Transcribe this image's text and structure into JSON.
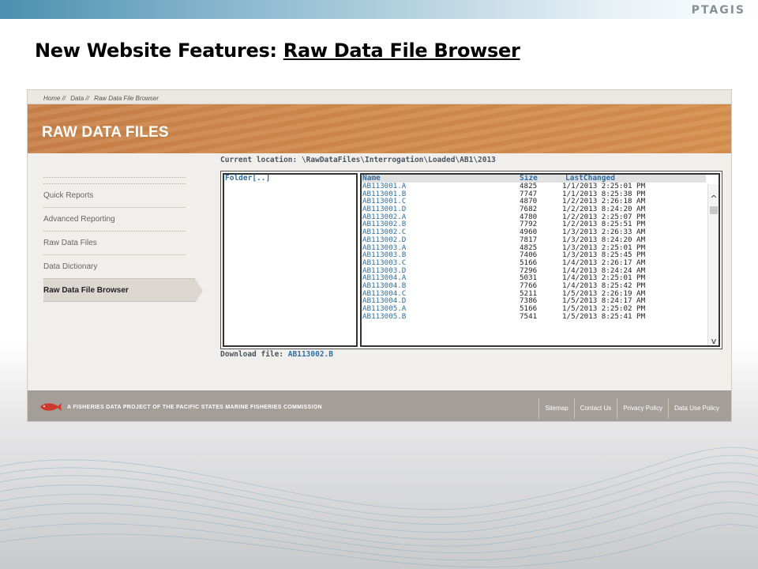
{
  "slide": {
    "logo": "PTAGIS",
    "title_prefix": "New Website Features: ",
    "title_underlined": "Raw Data File Browser"
  },
  "breadcrumb": [
    "Home //",
    "Data //",
    "Raw Data File Browser"
  ],
  "hero": {
    "title": "RAW DATA FILES"
  },
  "sidebar": {
    "items": [
      {
        "label": "Quick Reports",
        "active": false
      },
      {
        "label": "Advanced Reporting",
        "active": false
      },
      {
        "label": "Raw Data Files",
        "active": false
      },
      {
        "label": "Data Dictionary",
        "active": false
      },
      {
        "label": "Raw Data File Browser",
        "active": true
      }
    ]
  },
  "browser": {
    "current_location_label": "Current location: ",
    "current_location_path": "\\RawDataFiles\\Interrogation\\Loaded\\AB1\\2013",
    "folder_item": "Folder[..]",
    "columns": [
      "Name",
      "Size",
      "LastChanged"
    ],
    "rows": [
      [
        "AB113001.A",
        "4825",
        "1/1/2013 2:25:01 PM"
      ],
      [
        "AB113001.B",
        "7747",
        "1/1/2013 8:25:38 PM"
      ],
      [
        "AB113001.C",
        "4870",
        "1/2/2013 2:26:18 AM"
      ],
      [
        "AB113001.D",
        "7682",
        "1/2/2013 8:24:20 AM"
      ],
      [
        "AB113002.A",
        "4780",
        "1/2/2013 2:25:07 PM"
      ],
      [
        "AB113002.B",
        "7792",
        "1/2/2013 8:25:51 PM"
      ],
      [
        "AB113002.C",
        "4960",
        "1/3/2013 2:26:33 AM"
      ],
      [
        "AB113002.D",
        "7817",
        "1/3/2013 8:24:20 AM"
      ],
      [
        "AB113003.A",
        "4825",
        "1/3/2013 2:25:01 PM"
      ],
      [
        "AB113003.B",
        "7406",
        "1/3/2013 8:25:45 PM"
      ],
      [
        "AB113003.C",
        "5166",
        "1/4/2013 2:26:17 AM"
      ],
      [
        "AB113003.D",
        "7296",
        "1/4/2013 8:24:24 AM"
      ],
      [
        "AB113004.A",
        "5031",
        "1/4/2013 2:25:01 PM"
      ],
      [
        "AB113004.B",
        "7766",
        "1/4/2013 8:25:42 PM"
      ],
      [
        "AB113004.C",
        "5211",
        "1/5/2013 2:26:19 AM"
      ],
      [
        "AB113004.D",
        "7386",
        "1/5/2013 8:24:17 AM"
      ],
      [
        "AB113005.A",
        "5166",
        "1/5/2013 2:25:02 PM"
      ],
      [
        "AB113005.B",
        "7541",
        "1/5/2013 8:25:41 PM"
      ]
    ],
    "scroll_up": "^",
    "scroll_down": "v",
    "download_label": "Download file: ",
    "download_file": "AB113002.B"
  },
  "footer": {
    "text_prefix": "A FISHERIES DATA PROJECT OF THE ",
    "text_org": "PACIFIC STATES MARINE FISHERIES COMMISSION",
    "links": [
      "Sitemap",
      "Contact Us",
      "Privacy Policy",
      "Data Use Policy"
    ]
  },
  "colors": {
    "accent_orange": "#d08a4c",
    "link_blue": "#2e6fa7",
    "footer_gray": "#a39e98",
    "top_band_blue": "#4c8fb0"
  }
}
